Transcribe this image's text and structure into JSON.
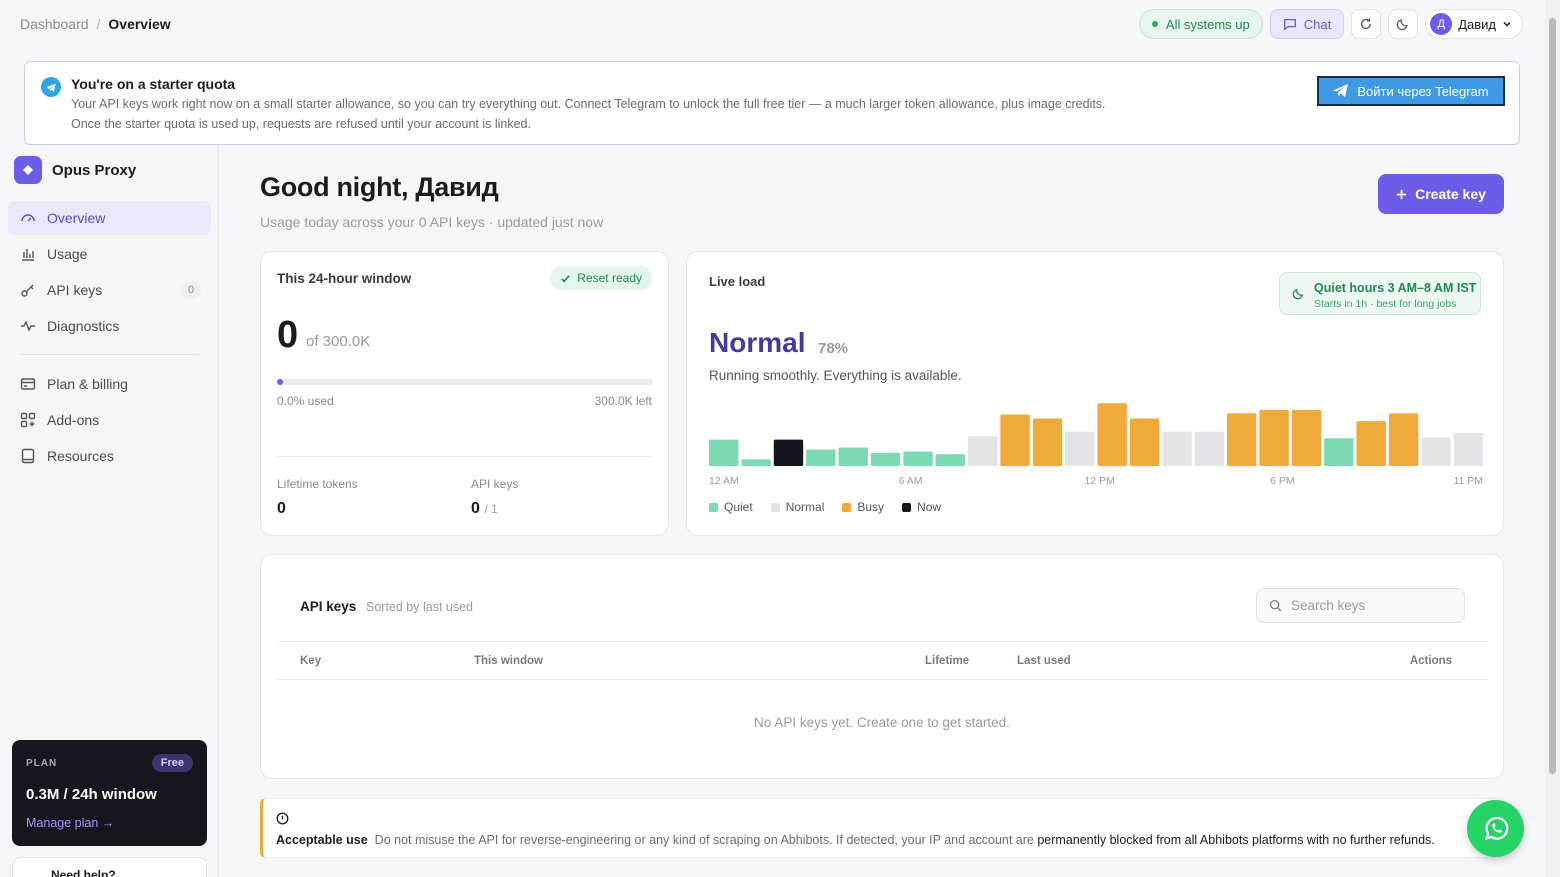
{
  "breadcrumb": {
    "root": "Dashboard",
    "separator": "/",
    "current": "Overview"
  },
  "topbar": {
    "status": "All systems up",
    "chat": "Chat",
    "user_initial": "Д",
    "user_name": "Давид"
  },
  "banner": {
    "title": "You're on a starter quota",
    "line1": "Your API keys work right now on a small starter allowance, so you can try everything out. Connect Telegram to unlock the full free tier — a much larger token allowance, plus image credits.",
    "line2": "Once the starter quota is used up, requests are refused until your account is linked.",
    "button": "Войти через Telegram"
  },
  "sidebar": {
    "brand": "Opus Proxy",
    "items": [
      {
        "label": "Overview",
        "icon": "gauge-icon"
      },
      {
        "label": "Usage",
        "icon": "bar-chart-icon"
      },
      {
        "label": "API keys",
        "icon": "key-icon",
        "count": "0"
      },
      {
        "label": "Diagnostics",
        "icon": "pulse-icon"
      },
      {
        "label": "Plan & billing",
        "icon": "card-icon"
      },
      {
        "label": "Add-ons",
        "icon": "grid-plus-icon"
      },
      {
        "label": "Resources",
        "icon": "book-icon"
      }
    ],
    "plan": {
      "label": "PLAN",
      "badge": "Free",
      "amount": "0.3M / 24h window",
      "manage": "Manage plan →"
    },
    "help": "Need help?"
  },
  "header": {
    "greeting": "Good night, Давид",
    "subtitle": "Usage today across your 0 API keys · updated just now",
    "create": "Create key"
  },
  "window_card": {
    "title": "This 24-hour window",
    "reset": "Reset ready",
    "used_value": "0",
    "of_text": "of 300.0K",
    "used_fraction": 0.0,
    "used_label": "0.0% used",
    "left_label": "300.0K left",
    "lifetime_label": "Lifetime tokens",
    "lifetime_value": "0",
    "keys_label": "API keys",
    "keys_value": "0",
    "keys_max": "/ 1"
  },
  "load_card": {
    "title": "Live load",
    "quiet_title": "Quiet hours 3 AM–8 AM IST",
    "quiet_sub": "Starts in 1h · best for long jobs",
    "state": "Normal",
    "percent": "78%",
    "description": "Running smoothly. Everything is available.",
    "ticks": [
      "12 AM",
      "6 AM",
      "12 PM",
      "6 PM",
      "11 PM"
    ],
    "legend": [
      {
        "label": "Quiet",
        "color": "#7dd9b4"
      },
      {
        "label": "Normal",
        "color": "#e3e3e8"
      },
      {
        "label": "Busy",
        "color": "#f0a93b"
      },
      {
        "label": "Now",
        "color": "#15151f"
      }
    ]
  },
  "chart_data": {
    "type": "bar",
    "categories": [
      "0",
      "1",
      "2",
      "3",
      "4",
      "5",
      "6",
      "7",
      "8",
      "9",
      "10",
      "11",
      "12",
      "13",
      "14",
      "15",
      "16",
      "17",
      "18",
      "19",
      "20",
      "21",
      "22",
      "23"
    ],
    "values": [
      40,
      10,
      40,
      25,
      28,
      20,
      22,
      18,
      45,
      78,
      72,
      52,
      95,
      72,
      52,
      52,
      80,
      85,
      85,
      42,
      68,
      80,
      43,
      50
    ],
    "levels": [
      "quiet",
      "quiet",
      "now",
      "quiet",
      "quiet",
      "quiet",
      "quiet",
      "quiet",
      "normal",
      "busy",
      "busy",
      "normal",
      "busy",
      "busy",
      "normal",
      "normal",
      "busy",
      "busy",
      "busy",
      "quiet",
      "busy",
      "busy",
      "normal",
      "normal"
    ],
    "ylim": [
      0,
      100
    ]
  },
  "keys_card": {
    "title": "API keys",
    "sort": "Sorted by last used",
    "search_placeholder": "Search keys",
    "columns": [
      "Key",
      "This window",
      "Lifetime",
      "Last used",
      "Actions"
    ],
    "empty": "No API keys yet. Create one to get started."
  },
  "notice": {
    "label": "Acceptable use",
    "text": "Do not misuse the API for reverse-engineering or any kind of scraping on Abhibots. If detected, your IP and account are",
    "emphasis": "permanently blocked from all Abhibots platforms with no further refunds."
  },
  "colors": {
    "accent": "#6c5ce7",
    "quiet": "#7dd9b4",
    "normal": "#e3e3e8",
    "busy": "#f0a93b",
    "now": "#15151f"
  }
}
